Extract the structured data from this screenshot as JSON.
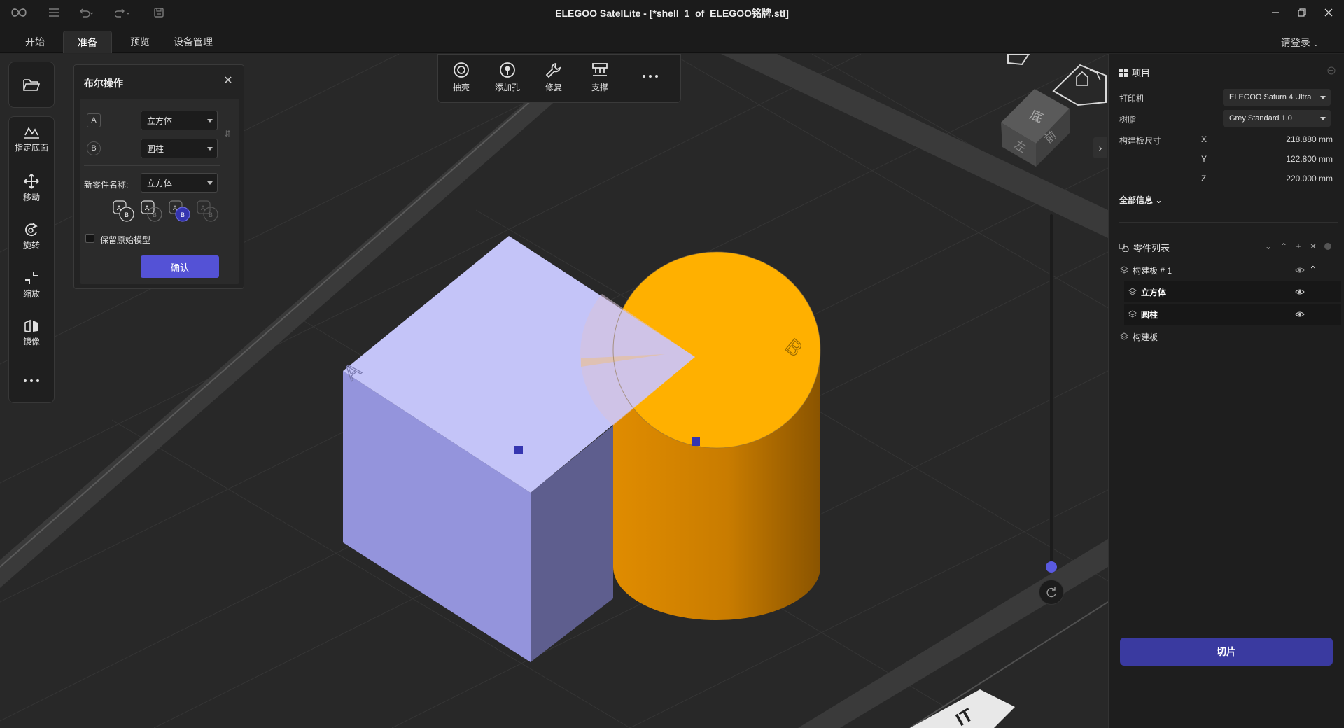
{
  "window": {
    "title": "ELEGOO SatelLite - [*shell_1_of_ELEGOO铭牌.stl]"
  },
  "tabs": [
    {
      "label": "开始"
    },
    {
      "label": "准备"
    },
    {
      "label": "预览"
    },
    {
      "label": "设备管理"
    }
  ],
  "account": {
    "login_label": "请登录"
  },
  "left_toolbar": {
    "items": [
      {
        "label": "指定底面",
        "icon": "lay-flat-icon"
      },
      {
        "label": "移动",
        "icon": "move-icon"
      },
      {
        "label": "旋转",
        "icon": "rotate-icon"
      },
      {
        "label": "缩放",
        "icon": "scale-icon"
      },
      {
        "label": "镜像",
        "icon": "mirror-icon"
      }
    ]
  },
  "boolean_panel": {
    "title": "布尔操作",
    "a_label": "A",
    "a_value": "立方体",
    "b_label": "B",
    "b_value": "圆柱",
    "new_name_label": "新零件名称:",
    "new_name_value": "立方体",
    "keep_original_label": "保留原始模型",
    "confirm_label": "确认",
    "ops": [
      "union",
      "subtract-b",
      "intersect",
      "subtract-a"
    ],
    "selected_op": "intersect"
  },
  "top_tools": [
    {
      "label": "抽壳",
      "icon": "hollow-icon"
    },
    {
      "label": "添加孔",
      "icon": "add-hole-icon"
    },
    {
      "label": "修复",
      "icon": "repair-icon"
    },
    {
      "label": "支撑",
      "icon": "support-icon"
    }
  ],
  "scene": {
    "cube_label": "A",
    "cylinder_label": "B",
    "nav_cube_labels": {
      "top": "底",
      "left": "左",
      "front": "前"
    },
    "plate_text": "IT",
    "colors": {
      "cube": "#c4c4f8",
      "cylinder": "#ffb000",
      "handle": "#3535b0"
    }
  },
  "right_panel": {
    "project_title": "项目",
    "printer_label": "打印机",
    "printer_value": "ELEGOO Saturn 4 Ultra",
    "resin_label": "树脂",
    "resin_value": "Grey Standard 1.0",
    "build_size_label": "构建板尺寸",
    "x_label": "X",
    "x_value": "218.880 mm",
    "y_label": "Y",
    "y_value": "122.800 mm",
    "z_label": "Z",
    "z_value": "220.000 mm",
    "all_info_label": "全部信息",
    "parts_title": "零件列表",
    "parts": [
      {
        "label": "构建板 # 1"
      },
      {
        "label": "立方体"
      },
      {
        "label": "圆柱"
      },
      {
        "label": "构建板"
      }
    ],
    "slice_label": "切片"
  }
}
